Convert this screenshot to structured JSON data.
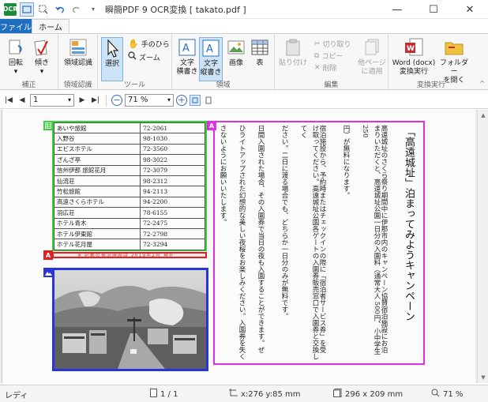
{
  "window": {
    "title": "瞬簡PDF 9 OCR変換 [ takato.pdf ]",
    "app_icon_text": "OCR",
    "buttons": {
      "minimize": "—",
      "maximize": "☐",
      "close": "✕"
    }
  },
  "tabs": {
    "file": "ファイル",
    "home": "ホーム"
  },
  "ribbon": {
    "groups": {
      "correction": "補正",
      "region_recog": "領域認識",
      "tools": "ツール",
      "region": "領域",
      "edit": "編集",
      "convert": "変換実行"
    },
    "buttons": {
      "rotate": "回転",
      "tilt": "傾き",
      "region_recog": "領域認識",
      "select": "選択",
      "hand": "手のひら",
      "zoom": "ズーム",
      "text_horizontal_1": "文字",
      "text_horizontal_2": "横書き",
      "text_vertical_1": "文字",
      "text_vertical_2": "縦書き",
      "image": "画像",
      "table": "表",
      "paste": "貼り付け",
      "cut": "切り取り",
      "copy": "コピー",
      "delete": "削除",
      "other_pages_1": "他ページ",
      "other_pages_2": "に適用",
      "word_1": "Word (docx)",
      "word_2": "変換実行",
      "folder_1": "フォルダー",
      "folder_2": "を開く"
    }
  },
  "pagebar": {
    "page": "1",
    "zoom": "71 %"
  },
  "document": {
    "hotels": [
      {
        "name": "あいや旅館",
        "tel": "72-2061"
      },
      {
        "name": "入野谷",
        "tel": "98-1030"
      },
      {
        "name": "エビスホテル",
        "tel": "72-3560"
      },
      {
        "name": "ざんざ亭",
        "tel": "98-3022"
      },
      {
        "name": "信州伊那 旅館花月",
        "tel": "72-3079"
      },
      {
        "name": "仙流荘",
        "tel": "98-2312"
      },
      {
        "name": "竹松旅館",
        "tel": "94-2113"
      },
      {
        "name": "高遠さくらホテル",
        "tel": "94-2200"
      },
      {
        "name": "羽広荘",
        "tel": "78-6155"
      },
      {
        "name": "ホテル青木",
        "tel": "72-2475"
      },
      {
        "name": "ホテル伊東館",
        "tel": "72-2798"
      },
      {
        "name": "ホテル花月屋",
        "tel": "72-3294"
      }
    ],
    "red_strip_text": "※ 記載の宿泊施設は 2019年2月 現在",
    "title": "「高遠城址」泊まってみようキャンペーン",
    "columns": [
      "高遠城址のさくら祭り期間中に伊那市内のキャンペーン協賛宿泊施設にお泊",
      "まりいただくと、高遠城址公園一日分の入園料（通常大人 500円、小中学生 250",
      "円）が無料になります。",
      "宿泊施設から、予約時またはチェックインの際に「宿泊者サービス券」を受",
      "け取ってください。高遠城址公園各ゲートの入園券販売窓口で入園券と交換してく",
      "ださい。二日に渡る場合でも、どちらか一日分のみが無料です。",
      "日間入園された場合、その入園券で当日の夜も入園することができます。ぜ",
      "ひライトアップされた幻想的な美しい夜桜をお楽しみください。入園券を失く",
      "さないようにお願いいたします。"
    ]
  },
  "status": {
    "ready": "レディ",
    "pages": "1 / 1",
    "coords": "x:276 y:85 mm",
    "size": "296 x 209 mm",
    "zoom": "71 %"
  }
}
